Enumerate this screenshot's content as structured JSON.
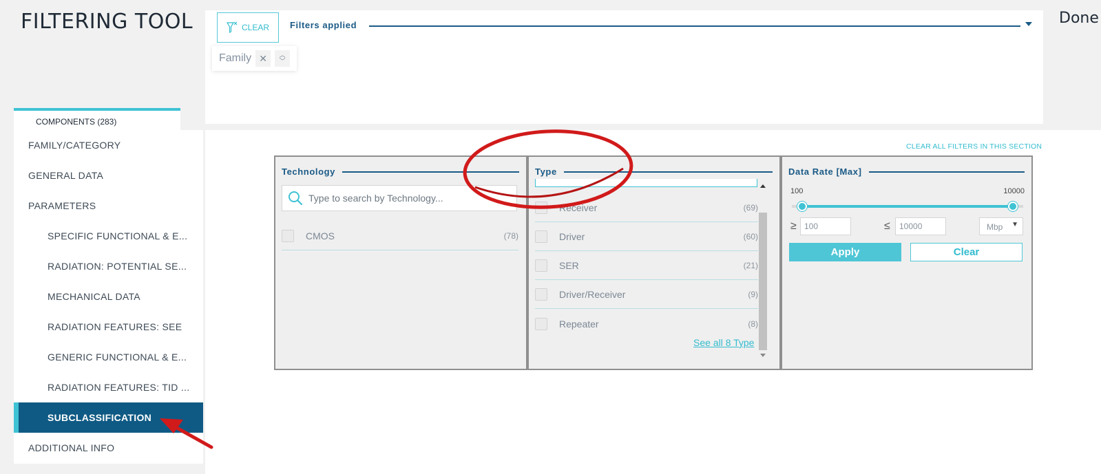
{
  "app_title": "FILTERING TOOL",
  "done_label": "Done",
  "filters_bar": {
    "clear_label": "CLEAR",
    "filters_applied_label": "Filters applied",
    "chips": [
      {
        "label": "Family"
      }
    ]
  },
  "sidebar": {
    "tab_label": "COMPONENTS (283)",
    "items": [
      {
        "label": "FAMILY/CATEGORY"
      },
      {
        "label": "GENERAL DATA"
      },
      {
        "label": "PARAMETERS"
      },
      {
        "label": "SPECIFIC FUNCTIONAL & E..."
      },
      {
        "label": "RADIATION: POTENTIAL SE..."
      },
      {
        "label": "MECHANICAL DATA"
      },
      {
        "label": "RADIATION FEATURES: SEE"
      },
      {
        "label": "GENERIC FUNCTIONAL & E..."
      },
      {
        "label": "RADIATION FEATURES: TID ..."
      },
      {
        "label": "SUBCLASSIFICATION"
      },
      {
        "label": "ADDITIONAL INFO"
      }
    ],
    "active_item": "SUBCLASSIFICATION"
  },
  "main": {
    "clear_section_label": "CLEAR ALL FILTERS IN THIS SECTION",
    "technology": {
      "title": "Technology",
      "search_placeholder": "Type to search by Technology...",
      "options": [
        {
          "label": "CMOS",
          "count": "(78)"
        }
      ]
    },
    "type": {
      "title": "Type",
      "options": [
        {
          "label": "Receiver",
          "count": "(69)"
        },
        {
          "label": "Driver",
          "count": "(60)"
        },
        {
          "label": "SER",
          "count": "(21)"
        },
        {
          "label": "Driver/Receiver",
          "count": "(9)"
        },
        {
          "label": "Repeater",
          "count": "(8)"
        }
      ],
      "see_all_label": "See all 8 Type"
    },
    "data_rate": {
      "title": "Data Rate [Max]",
      "range_min": "100",
      "range_max": "10000",
      "gte_symbol": "≥",
      "lte_symbol": "≤",
      "min_value": "100",
      "max_value": "10000",
      "unit": "Mbp",
      "apply_label": "Apply",
      "clear_label": "Clear"
    }
  },
  "colors": {
    "accent": "#3fc2d4",
    "primary": "#0f5a84",
    "annotation_red": "#d11a1a"
  },
  "icons": {
    "clear_filter": "filter-clear-icon",
    "chip_remove": "close-icon",
    "chip_sort": "sort-icon",
    "search": "search-icon",
    "dropdown": "caret-down-icon"
  }
}
